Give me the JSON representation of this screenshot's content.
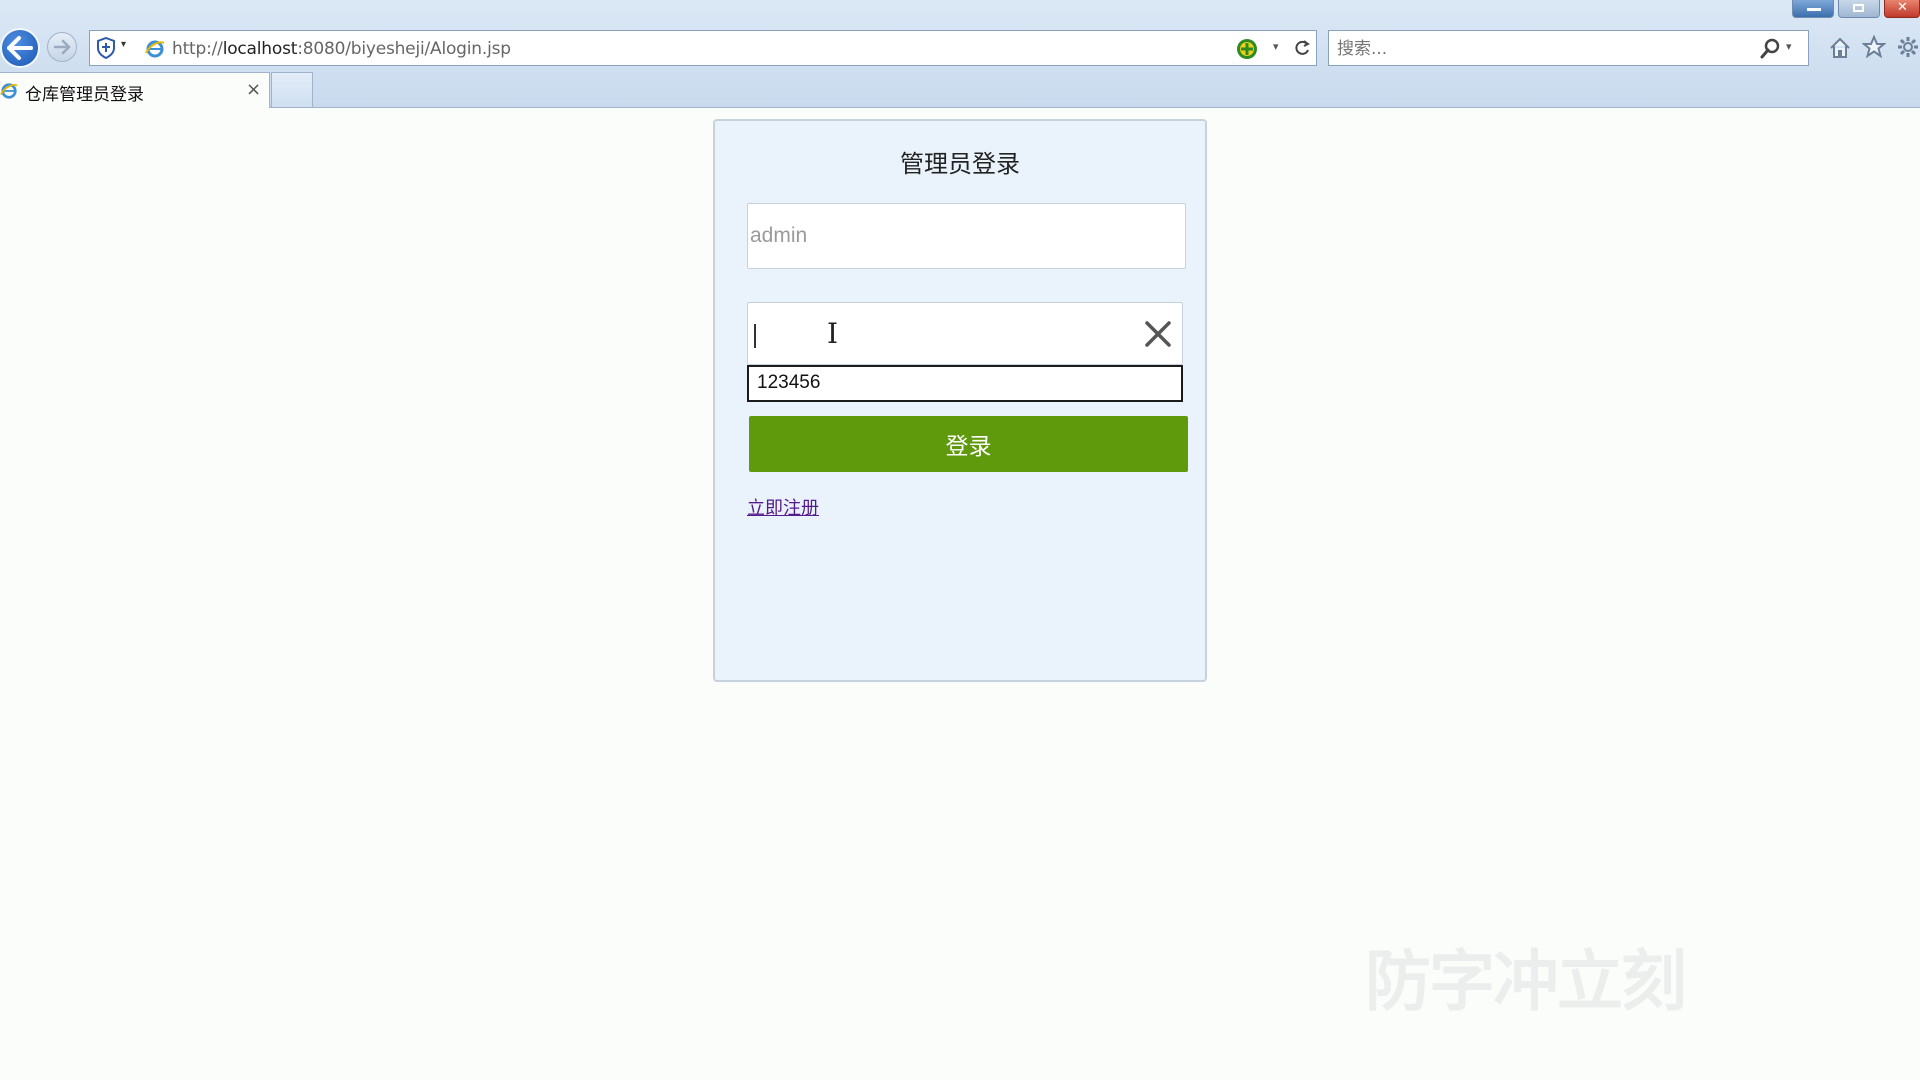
{
  "browser": {
    "address_url_prefix": "http://",
    "address_url_host": "localhost",
    "address_url_path": ":8080/biyesheji/Alogin.jsp",
    "search_placeholder": "搜索...",
    "tab_title": "仓库管理员登录",
    "tab_close": "×",
    "dropdown_glyph": "▾"
  },
  "login": {
    "title": "管理员登录",
    "username_placeholder": "admin",
    "ibeam": "I",
    "autocomplete_value": "123456",
    "login_button": "登录",
    "register_link": "立即注册"
  },
  "colors": {
    "accent_green": "#5f9a0c",
    "panel_bg": "#eaf3fc",
    "visited_link": "#551a8b"
  },
  "watermark": "防字冲立刻"
}
